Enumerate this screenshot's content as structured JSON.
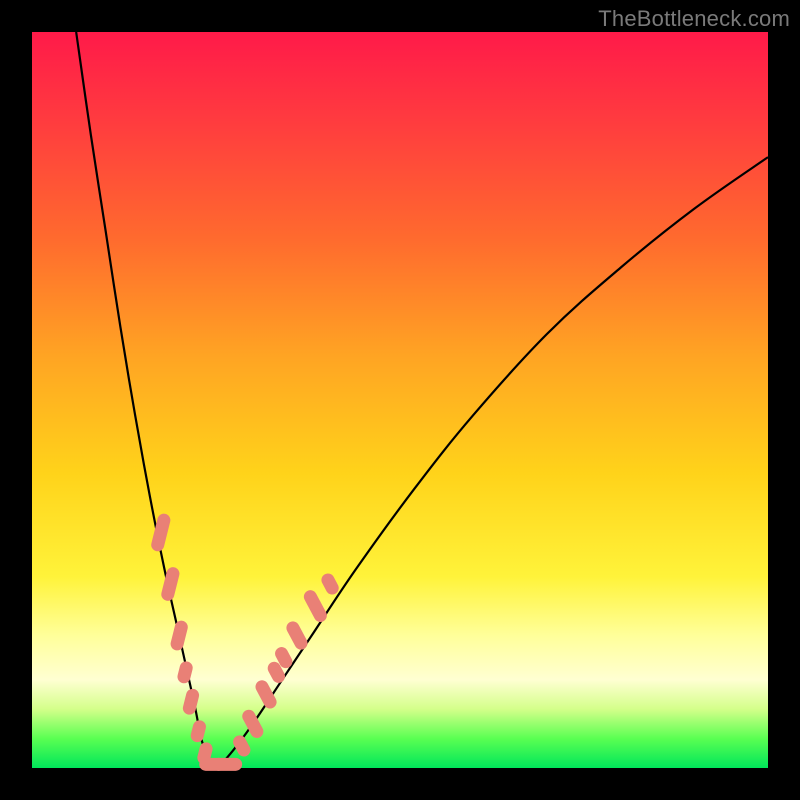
{
  "watermark": "TheBottleneck.com",
  "chart_data": {
    "type": "line",
    "title": "",
    "xlabel": "",
    "ylabel": "",
    "xlim": [
      0,
      100
    ],
    "ylim": [
      0,
      100
    ],
    "background_gradient": {
      "top_color": "#ff1a49",
      "mid_colors": [
        "#ff6a2e",
        "#ffd31a",
        "#ffff9a"
      ],
      "bottom_color": "#00e65a"
    },
    "series": [
      {
        "name": "bottleneck-curve",
        "color": "#000000",
        "x": [
          6,
          8,
          10,
          12,
          14,
          16,
          18,
          20,
          22,
          23,
          24,
          25,
          27,
          30,
          34,
          38,
          44,
          52,
          60,
          70,
          80,
          90,
          100
        ],
        "y": [
          100,
          86,
          73,
          60,
          48,
          37,
          27,
          18,
          9,
          4,
          1,
          0,
          2,
          6,
          12,
          18,
          27,
          38,
          48,
          59,
          68,
          76,
          83
        ]
      }
    ],
    "markers": [
      {
        "name": "left-branch-markers",
        "color": "#e98076",
        "shape": "rounded-rect",
        "points": [
          {
            "x": 17.5,
            "y": 32,
            "len": 7
          },
          {
            "x": 18.8,
            "y": 25,
            "len": 6
          },
          {
            "x": 20.0,
            "y": 18,
            "len": 5
          },
          {
            "x": 20.8,
            "y": 13,
            "len": 3
          },
          {
            "x": 21.6,
            "y": 9,
            "len": 4
          },
          {
            "x": 22.6,
            "y": 5,
            "len": 3
          },
          {
            "x": 23.5,
            "y": 2,
            "len": 3
          }
        ]
      },
      {
        "name": "trough-markers",
        "color": "#e98076",
        "shape": "rounded-rect-horizontal",
        "points": [
          {
            "x": 24.5,
            "y": 0.5,
            "len": 4
          },
          {
            "x": 26.5,
            "y": 0.5,
            "len": 5
          }
        ]
      },
      {
        "name": "right-branch-markers",
        "color": "#e98076",
        "shape": "rounded-rect",
        "points": [
          {
            "x": 28.5,
            "y": 3,
            "len": 3
          },
          {
            "x": 30.0,
            "y": 6,
            "len": 5
          },
          {
            "x": 31.8,
            "y": 10,
            "len": 5
          },
          {
            "x": 33.2,
            "y": 13,
            "len": 3
          },
          {
            "x": 34.2,
            "y": 15,
            "len": 3
          },
          {
            "x": 36.0,
            "y": 18,
            "len": 5
          },
          {
            "x": 38.5,
            "y": 22,
            "len": 6
          },
          {
            "x": 40.5,
            "y": 25,
            "len": 3
          }
        ]
      }
    ]
  }
}
